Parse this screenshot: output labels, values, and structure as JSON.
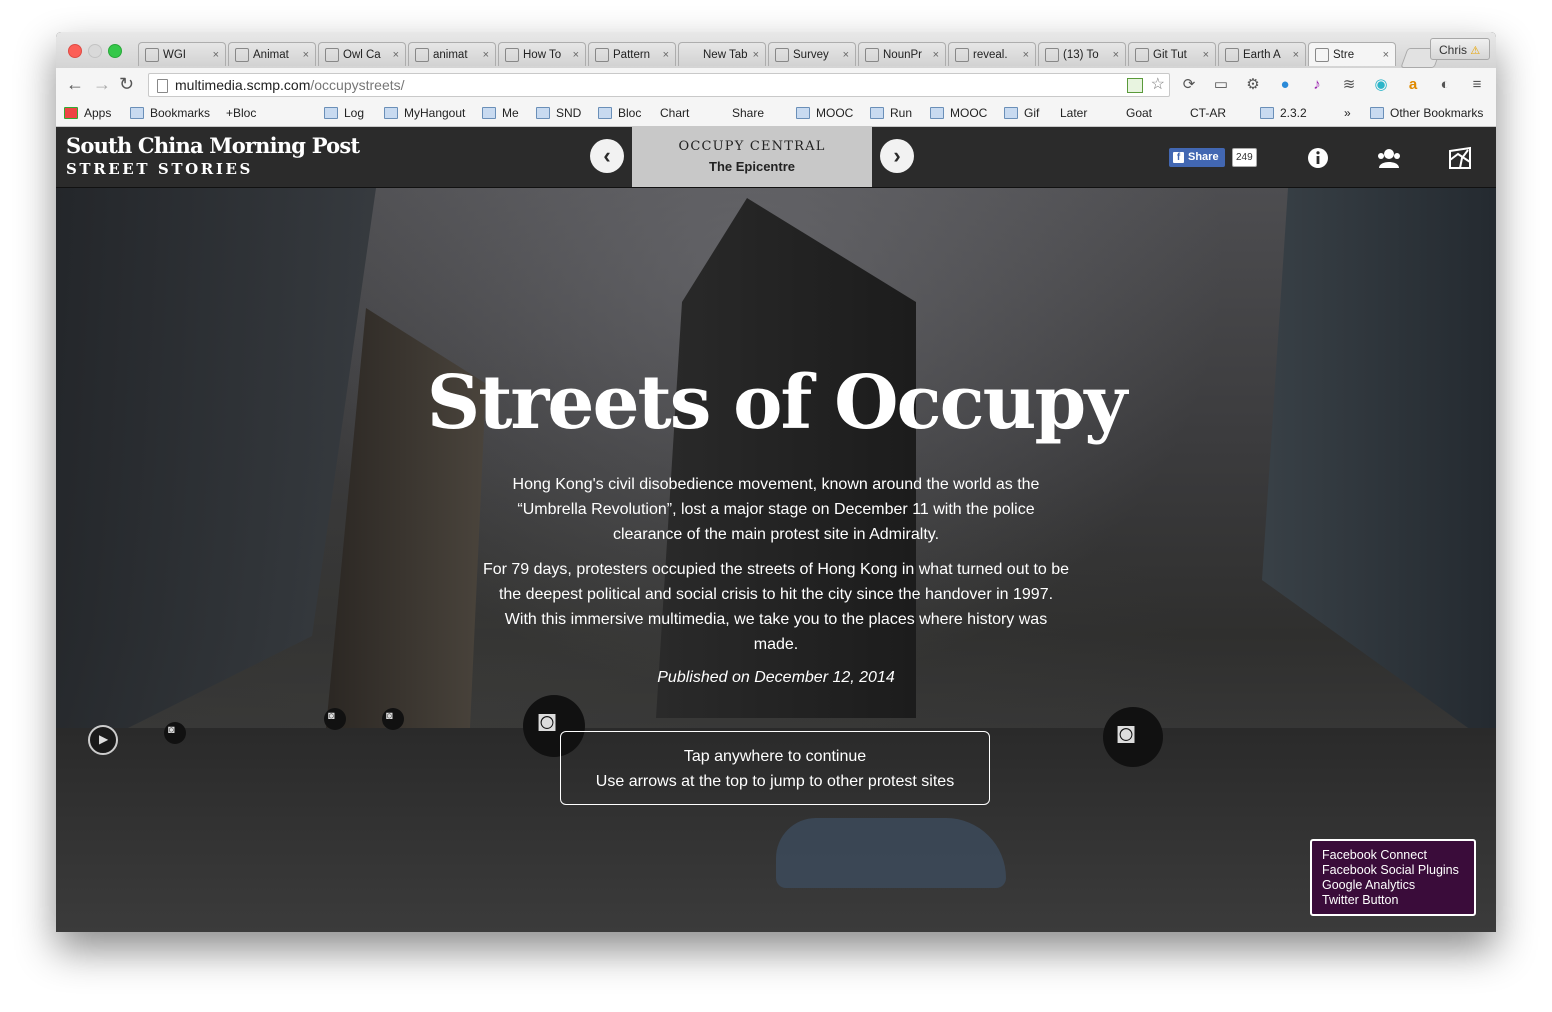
{
  "browser": {
    "tabs": [
      {
        "title": "WGI",
        "favicon": "w-icon"
      },
      {
        "title": "Animat",
        "favicon": "page-icon"
      },
      {
        "title": "Owl Ca",
        "favicon": "owl-icon"
      },
      {
        "title": "animat",
        "favicon": "grid-icon"
      },
      {
        "title": "How To",
        "favicon": "tg-icon"
      },
      {
        "title": "Pattern",
        "favicon": "page-icon"
      },
      {
        "title": "New Tab",
        "favicon": "none"
      },
      {
        "title": "Survey",
        "favicon": "q-icon"
      },
      {
        "title": "NounPr",
        "favicon": "noun-icon"
      },
      {
        "title": "reveal.",
        "favicon": "page-icon"
      },
      {
        "title": "(13) To",
        "favicon": "p-icon"
      },
      {
        "title": "Git Tut",
        "favicon": "db-icon"
      },
      {
        "title": "Earth A",
        "favicon": "earth-icon"
      },
      {
        "title": "Stre",
        "favicon": "scmp-icon"
      }
    ],
    "profile": "Chris",
    "url_domain": "multimedia.scmp.com",
    "url_path": "/occupystreets/",
    "bookmarks": [
      "Apps",
      "Bookmarks",
      "+Bloc",
      "Log",
      "MyHangout",
      "Me",
      "SND",
      "Bloc",
      "Chart",
      "Share",
      "MOOC",
      "Run",
      "MOOC",
      "Gif",
      "Later",
      "Goat",
      "CT-AR",
      "2.3.2"
    ],
    "bookmarks_overflow": "»",
    "other_bookmarks": "Other Bookmarks"
  },
  "site": {
    "logo_line1": "South China Morning Post",
    "logo_line2": "STREET STORIES",
    "current_site": "OCCUPY CENTRAL",
    "current_site_sub": "The Epicentre",
    "share_label": "Share",
    "share_count": "249"
  },
  "hero": {
    "title": "Streets of Occupy",
    "intro1": "Hong Kong's civil disobedience movement, known around the world as the “Umbrella Revolution”, lost a major stage on December 11 with the police clearance of the main protest site in Admiralty.",
    "intro2": "For 79 days, protesters occupied the streets of Hong Kong in what turned out to be the deepest political and social crisis to hit the city since the handover in 1997. With this immersive multimedia, we take you to the places where history was made.",
    "published": "Published on December 12, 2014",
    "tap_line1": "Tap anywhere to continue",
    "tap_line2": "Use arrows at the top to jump to other protest sites"
  },
  "analytics_popup": [
    "Facebook Connect",
    "Facebook Social Plugins",
    "Google Analytics",
    "Twitter Button"
  ],
  "colors": {
    "header_bg": "#2b2b2b",
    "site_box_bg": "#c8c8c8",
    "fb_blue": "#4267b2",
    "popup_bg": "#3a0c3a"
  }
}
